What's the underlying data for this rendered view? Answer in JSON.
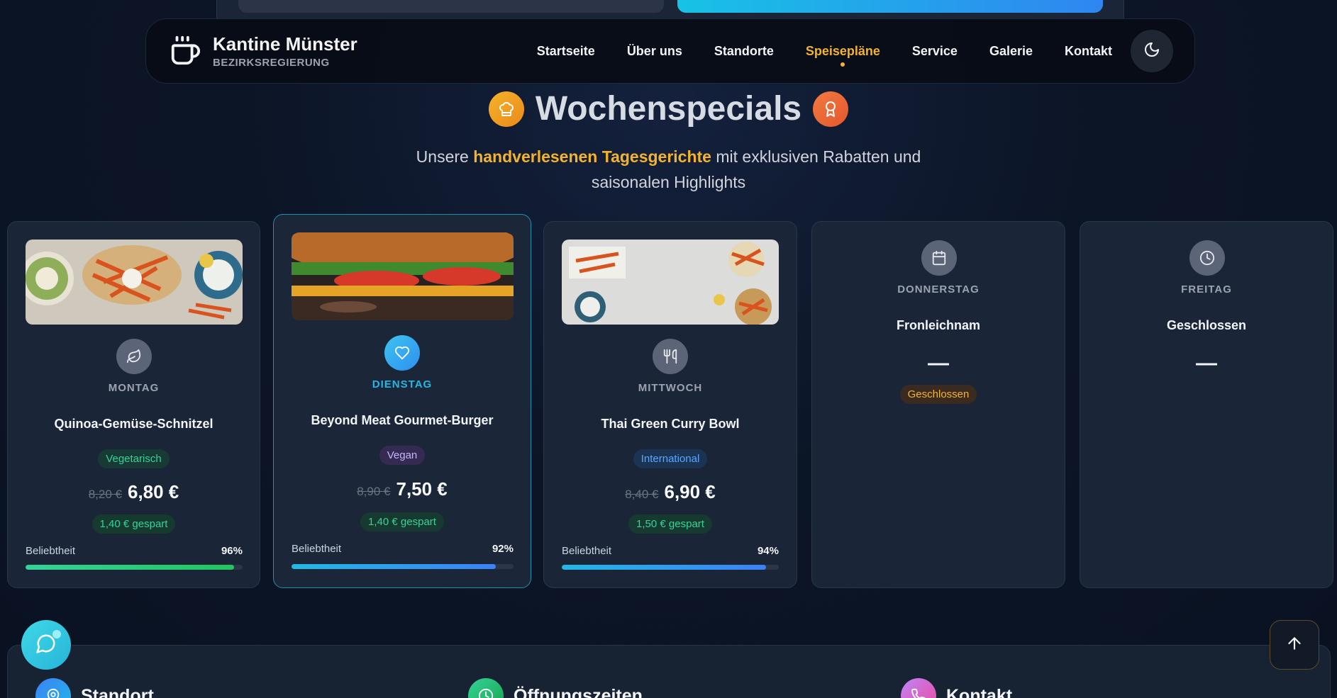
{
  "nav": {
    "brand_title": "Kantine Münster",
    "brand_subtitle": "BEZIRKSREGIERUNG",
    "links": [
      "Startseite",
      "Über uns",
      "Standorte",
      "Speisepläne",
      "Service",
      "Galerie",
      "Kontakt"
    ],
    "active_link": "Speisepläne",
    "theme_icon": "moon-icon"
  },
  "section": {
    "title": "Wochenspecials",
    "subtitle_pre": "Unsere ",
    "subtitle_highlight": "handverlesenen Tagesgerichte",
    "subtitle_post": " mit exklusiven Rabatten und saisonalen Highlights"
  },
  "cards": [
    {
      "day": "MONTAG",
      "dish": "Quinoa-Gemüse-Schnitzel",
      "tag": "Vegetarisch",
      "old_price": "8,20 €",
      "new_price": "6,80 €",
      "saved": "1,40 € gespart",
      "popularity_label": "Beliebtheit",
      "popularity": "96%",
      "popularity_value": 96,
      "icon": "leaf-icon"
    },
    {
      "day": "DIENSTAG",
      "dish": "Beyond Meat Gourmet-Burger",
      "tag": "Vegan",
      "old_price": "8,90 €",
      "new_price": "7,50 €",
      "saved": "1,40 € gespart",
      "popularity_label": "Beliebtheit",
      "popularity": "92%",
      "popularity_value": 92,
      "icon": "heart-icon"
    },
    {
      "day": "MITTWOCH",
      "dish": "Thai Green Curry Bowl",
      "tag": "International",
      "old_price": "8,40 €",
      "new_price": "6,90 €",
      "saved": "1,50 € gespart",
      "popularity_label": "Beliebtheit",
      "popularity": "94%",
      "popularity_value": 94,
      "icon": "utensils-icon"
    },
    {
      "day": "DONNERSTAG",
      "dish": "Fronleichnam",
      "dash": "—",
      "status": "Geschlossen",
      "icon": "calendar-icon"
    },
    {
      "day": "FREITAG",
      "dish": "Geschlossen",
      "dash": "—",
      "icon": "clock-icon"
    }
  ],
  "bottom": {
    "items": [
      {
        "label": "Standort",
        "icon": "map-pin-icon"
      },
      {
        "label": "Öffnungszeiten",
        "icon": "clock-icon"
      },
      {
        "label": "Kontakt",
        "icon": "phone-icon"
      }
    ]
  },
  "colors": {
    "accent": "#f5b32a",
    "cyan": "#22b8e6",
    "green": "#34d399"
  }
}
